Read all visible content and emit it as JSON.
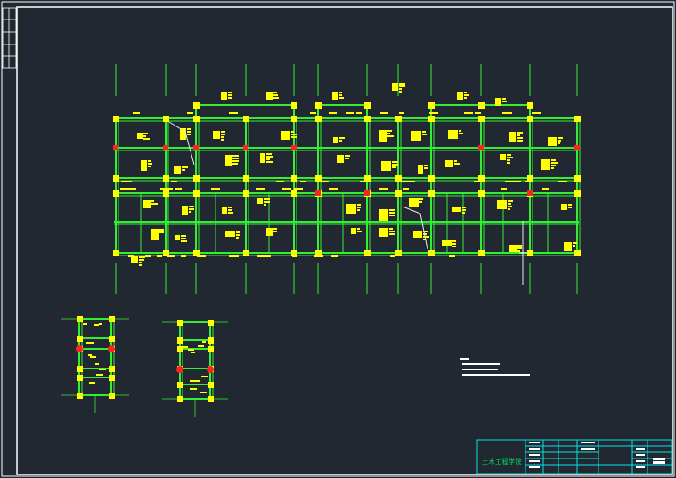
{
  "drawing": {
    "title_block_label": "土木工程学院",
    "colors": {
      "background": "#222831",
      "frame": "#ffffff",
      "beam": "#33ee33",
      "column": "#ffff00",
      "annotation": "#ffff00",
      "section_mark": "#ff2222",
      "title_block": "#00e5e5"
    }
  }
}
